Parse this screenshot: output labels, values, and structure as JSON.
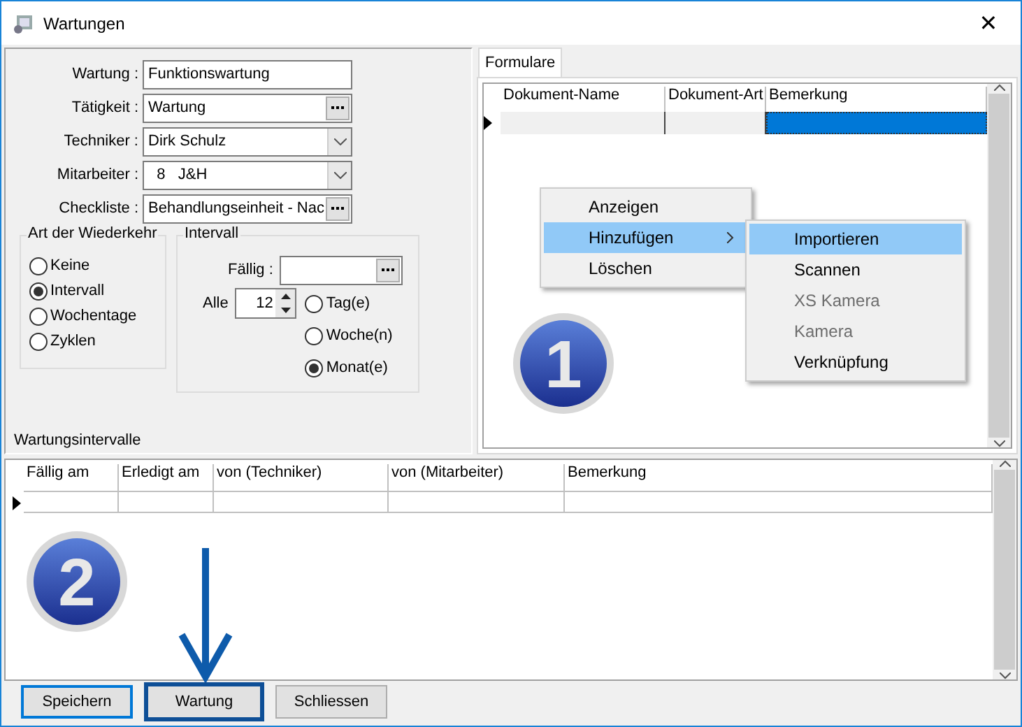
{
  "window": {
    "title": "Wartungen",
    "close": "✕"
  },
  "fields": [
    {
      "label": "Wartung :",
      "value": "Funktionswartung",
      "kind": "text"
    },
    {
      "label": "Tätigkeit :",
      "value": "Wartung",
      "kind": "browse"
    },
    {
      "label": "Techniker :",
      "value": "Dirk Schulz",
      "kind": "combo"
    },
    {
      "label": "Mitarbeiter :",
      "value": "  8   J&H",
      "kind": "combo"
    },
    {
      "label": "Checkliste :",
      "value": "Behandlungseinheit - Nac",
      "kind": "browse"
    }
  ],
  "recurrence": {
    "title": "Art der Wiederkehr",
    "options": [
      {
        "label": "Keine",
        "selected": false
      },
      {
        "label": "Intervall",
        "selected": true
      },
      {
        "label": "Wochentage",
        "selected": false
      },
      {
        "label": "Zyklen",
        "selected": false
      }
    ]
  },
  "interval": {
    "title": "Intervall",
    "due_label": "Fällig :",
    "every_label": "Alle",
    "every_value": "12",
    "units": [
      {
        "label": "Tag(e)",
        "selected": false
      },
      {
        "label": "Woche(n)",
        "selected": false
      },
      {
        "label": "Monat(e)",
        "selected": true
      }
    ]
  },
  "section_label": "Wartungsintervalle",
  "forms": {
    "tabs": [
      {
        "label": "Formulare",
        "selected": true
      }
    ],
    "columns": [
      "Dokument-Name",
      "Dokument-Art",
      "Bemerkung"
    ]
  },
  "context_menu": {
    "items": [
      {
        "label": "Anzeigen",
        "selected": false,
        "has_submenu": false
      },
      {
        "label": "Hinzufügen",
        "selected": true,
        "has_submenu": true
      },
      {
        "label": "Löschen",
        "selected": false,
        "has_submenu": false
      }
    ],
    "submenu": [
      {
        "label": "Importieren",
        "selected": true,
        "disabled": false
      },
      {
        "label": "Scannen",
        "selected": false,
        "disabled": false
      },
      {
        "label": "XS Kamera",
        "selected": false,
        "disabled": true
      },
      {
        "label": "Kamera",
        "selected": false,
        "disabled": true
      },
      {
        "label": "Verknüpfung",
        "selected": false,
        "disabled": false
      }
    ]
  },
  "badges": [
    "1",
    "2"
  ],
  "interval_table": {
    "columns": [
      "Fällig am",
      "Erledigt am",
      "von (Techniker)",
      "von (Mitarbeiter)",
      "Bemerkung"
    ]
  },
  "buttons": [
    {
      "label": "Speichern",
      "focused": true,
      "highlighted": false
    },
    {
      "label": "Wartung",
      "focused": false,
      "highlighted": true
    },
    {
      "label": "Schliessen",
      "focused": false,
      "highlighted": false
    }
  ]
}
